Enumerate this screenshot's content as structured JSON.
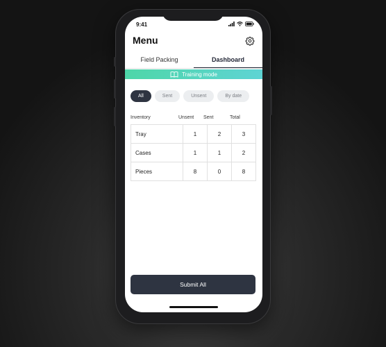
{
  "status": {
    "time": "9:41"
  },
  "header": {
    "title": "Menu"
  },
  "tabs": [
    {
      "label": "Field Packing",
      "active": false
    },
    {
      "label": "Dashboard",
      "active": true
    }
  ],
  "banner": {
    "label": "Training mode",
    "icon": "book-icon"
  },
  "filters": [
    {
      "label": "All",
      "active": true
    },
    {
      "label": "Sent",
      "active": false
    },
    {
      "label": "Unsent",
      "active": false
    },
    {
      "label": "By date",
      "active": false
    }
  ],
  "table": {
    "headers": [
      "Inventory",
      "Unsent",
      "Sent",
      "Total"
    ],
    "rows": [
      {
        "name": "Tray",
        "unsent": "1",
        "sent": "2",
        "total": "3"
      },
      {
        "name": "Cases",
        "unsent": "1",
        "sent": "1",
        "total": "2"
      },
      {
        "name": "Pieces",
        "unsent": "8",
        "sent": "0",
        "total": "8"
      }
    ]
  },
  "actions": {
    "submit_label": "Submit All"
  },
  "colors": {
    "accent_dark": "#2e3441",
    "banner_start": "#4ed6a8",
    "banner_end": "#5ed4d4"
  }
}
